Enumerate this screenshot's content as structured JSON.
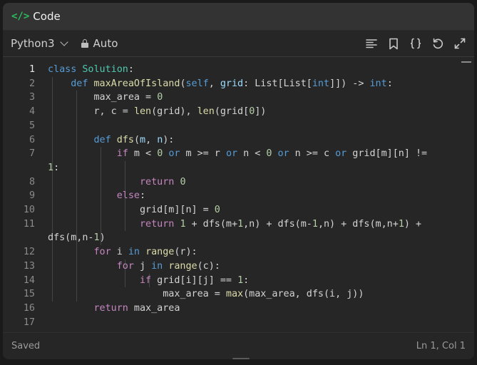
{
  "window": {
    "title": "Code",
    "title_icon": "</>"
  },
  "toolbar": {
    "language": "Python3",
    "mode": "Auto",
    "tools": [
      "format-icon",
      "bookmark-icon",
      "braces-icon",
      "reset-icon",
      "expand-icon"
    ]
  },
  "editor": {
    "lines": [
      {
        "n": "1",
        "tokens": [
          [
            "kw",
            "class"
          ],
          [
            "id",
            " "
          ],
          [
            "cls",
            "Solution"
          ],
          [
            "id",
            ":"
          ]
        ]
      },
      {
        "n": "2",
        "tokens": [
          [
            "id",
            "    "
          ],
          [
            "kw",
            "def"
          ],
          [
            "id",
            " "
          ],
          [
            "fn",
            "maxAreaOfIsland"
          ],
          [
            "id",
            "("
          ],
          [
            "kw",
            "self"
          ],
          [
            "id",
            ", "
          ],
          [
            "var",
            "grid"
          ],
          [
            "id",
            ": List[List["
          ],
          [
            "kw",
            "int"
          ],
          [
            "id",
            "]]) -> "
          ],
          [
            "kw",
            "int"
          ],
          [
            "id",
            ":"
          ]
        ]
      },
      {
        "n": "3",
        "tokens": [
          [
            "id",
            "        max_area = "
          ],
          [
            "num",
            "0"
          ]
        ]
      },
      {
        "n": "4",
        "tokens": [
          [
            "id",
            "        r, c = "
          ],
          [
            "fn",
            "len"
          ],
          [
            "id",
            "(grid), "
          ],
          [
            "fn",
            "len"
          ],
          [
            "id",
            "(grid["
          ],
          [
            "num",
            "0"
          ],
          [
            "id",
            "])"
          ]
        ]
      },
      {
        "n": "5",
        "tokens": []
      },
      {
        "n": "6",
        "tokens": [
          [
            "id",
            "        "
          ],
          [
            "kw",
            "def"
          ],
          [
            "id",
            " "
          ],
          [
            "fn",
            "dfs"
          ],
          [
            "id",
            "("
          ],
          [
            "var",
            "m"
          ],
          [
            "id",
            ", "
          ],
          [
            "var",
            "n"
          ],
          [
            "id",
            "):"
          ]
        ]
      },
      {
        "n": "7",
        "tokens": [
          [
            "id",
            "            "
          ],
          [
            "flow",
            "if"
          ],
          [
            "id",
            " m < "
          ],
          [
            "num",
            "0"
          ],
          [
            "id",
            " "
          ],
          [
            "kw",
            "or"
          ],
          [
            "id",
            " m >= r "
          ],
          [
            "kw",
            "or"
          ],
          [
            "id",
            " n < "
          ],
          [
            "num",
            "0"
          ],
          [
            "id",
            " "
          ],
          [
            "kw",
            "or"
          ],
          [
            "id",
            " n >= c "
          ],
          [
            "kw",
            "or"
          ],
          [
            "id",
            " grid[m][n] !="
          ]
        ]
      },
      {
        "n": "",
        "tokens": [
          [
            "num",
            "1"
          ],
          [
            "id",
            ":"
          ]
        ]
      },
      {
        "n": "8",
        "tokens": [
          [
            "id",
            "                "
          ],
          [
            "flow",
            "return"
          ],
          [
            "id",
            " "
          ],
          [
            "num",
            "0"
          ]
        ]
      },
      {
        "n": "9",
        "tokens": [
          [
            "id",
            "            "
          ],
          [
            "flow",
            "else"
          ],
          [
            "id",
            ":"
          ]
        ]
      },
      {
        "n": "10",
        "tokens": [
          [
            "id",
            "                grid[m][n] = "
          ],
          [
            "num",
            "0"
          ]
        ]
      },
      {
        "n": "11",
        "tokens": [
          [
            "id",
            "                "
          ],
          [
            "flow",
            "return"
          ],
          [
            "id",
            " "
          ],
          [
            "num",
            "1"
          ],
          [
            "id",
            " + dfs(m+"
          ],
          [
            "num",
            "1"
          ],
          [
            "id",
            ",n) + dfs(m-"
          ],
          [
            "num",
            "1"
          ],
          [
            "id",
            ",n) + dfs(m,n+"
          ],
          [
            "num",
            "1"
          ],
          [
            "id",
            ") +"
          ]
        ]
      },
      {
        "n": "",
        "tokens": [
          [
            "id",
            "dfs(m,n-"
          ],
          [
            "num",
            "1"
          ],
          [
            "id",
            ")"
          ]
        ]
      },
      {
        "n": "12",
        "tokens": [
          [
            "id",
            "        "
          ],
          [
            "flow",
            "for"
          ],
          [
            "id",
            " i "
          ],
          [
            "kw",
            "in"
          ],
          [
            "id",
            " "
          ],
          [
            "fn",
            "range"
          ],
          [
            "id",
            "(r):"
          ]
        ]
      },
      {
        "n": "13",
        "tokens": [
          [
            "id",
            "            "
          ],
          [
            "flow",
            "for"
          ],
          [
            "id",
            " j "
          ],
          [
            "kw",
            "in"
          ],
          [
            "id",
            " "
          ],
          [
            "fn",
            "range"
          ],
          [
            "id",
            "(c):"
          ]
        ]
      },
      {
        "n": "14",
        "tokens": [
          [
            "id",
            "                "
          ],
          [
            "flow",
            "if"
          ],
          [
            "id",
            " grid[i][j] == "
          ],
          [
            "num",
            "1"
          ],
          [
            "id",
            ":"
          ]
        ]
      },
      {
        "n": "15",
        "tokens": [
          [
            "id",
            "                    max_area = "
          ],
          [
            "fn",
            "max"
          ],
          [
            "id",
            "(max_area, dfs(i, j))"
          ]
        ]
      },
      {
        "n": "16",
        "tokens": [
          [
            "id",
            "        "
          ],
          [
            "flow",
            "return"
          ],
          [
            "id",
            " max_area"
          ]
        ]
      },
      {
        "n": "17",
        "tokens": []
      }
    ]
  },
  "status": {
    "saved": "Saved",
    "position": "Ln 1, Col 1"
  },
  "colors": {
    "accent": "#2cbb5d",
    "keyword": "#569cd6",
    "class": "#4ec9b0",
    "function": "#dcdcaa",
    "number": "#b5cea8",
    "flow": "#c586c0"
  }
}
